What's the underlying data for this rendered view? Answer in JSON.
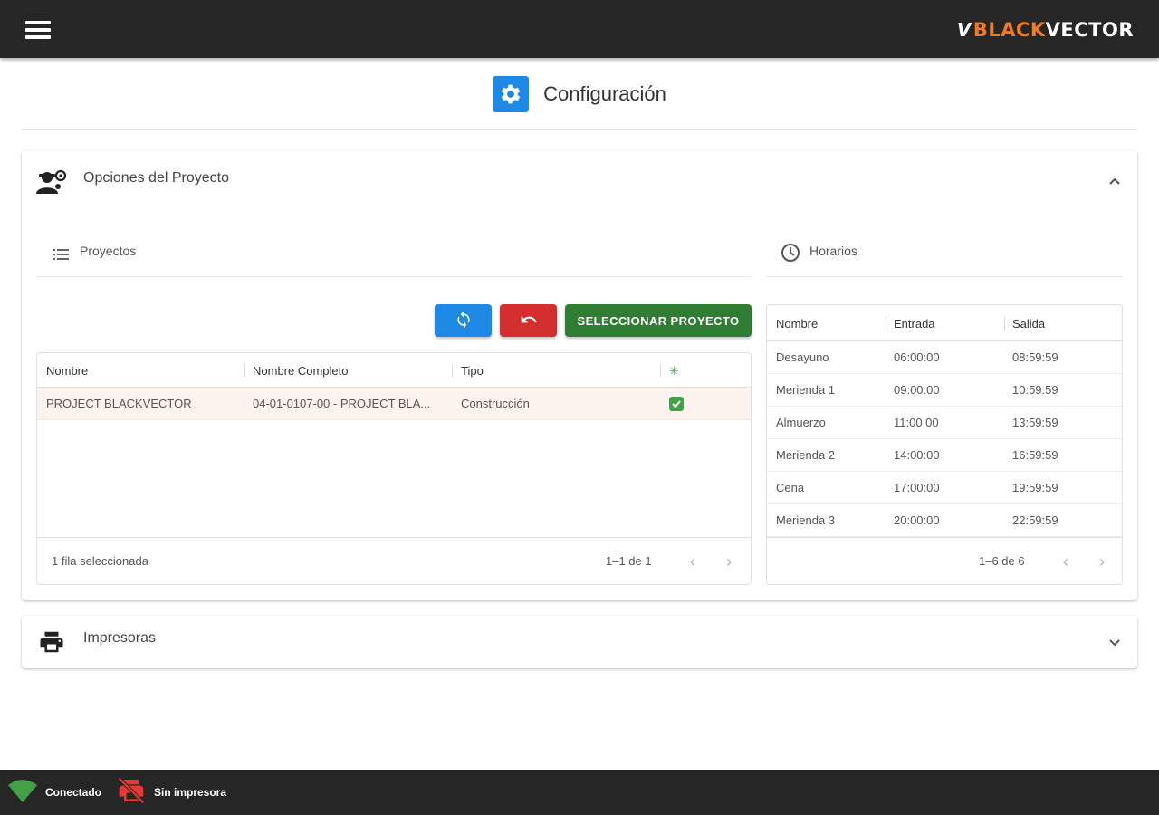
{
  "app": {
    "logo_mark": "V",
    "logo_black": "BLACK",
    "logo_vector": "VECTOR",
    "brand_color": "#f07c24"
  },
  "header": {
    "title": "Configuración",
    "icon": "gear-icon"
  },
  "project_panel": {
    "label": "Opciones del Proyecto",
    "icon": "user-settings-icon",
    "expanded": true,
    "projects": {
      "label": "Proyectos",
      "icon": "list-icon",
      "buttons": {
        "refresh_icon": "refresh-icon",
        "undo_icon": "undo-icon",
        "select_label": "SELECCIONAR PROYECTO"
      },
      "columns": [
        "Nombre",
        "Nombre Completo",
        "Tipo",
        "✳"
      ],
      "rows": [
        {
          "nombre": "PROJECT BLACKVECTOR",
          "nombre_completo": "04-01-0107-00 - PROJECT BLA...",
          "tipo": "Construcción",
          "active": "check-icon"
        }
      ],
      "footer": {
        "selected": "1 fila seleccionada",
        "range": "1–1 de 1"
      }
    },
    "horarios": {
      "label": "Horarios",
      "icon": "clock-icon",
      "columns": [
        "Nombre",
        "Entrada",
        "Salida"
      ],
      "rows": [
        {
          "nombre": "Desayuno",
          "entrada": "06:00:00",
          "salida": "08:59:59"
        },
        {
          "nombre": "Merienda 1",
          "entrada": "09:00:00",
          "salida": "10:59:59"
        },
        {
          "nombre": "Almuerzo",
          "entrada": "11:00:00",
          "salida": "13:59:59"
        },
        {
          "nombre": "Merienda 2",
          "entrada": "14:00:00",
          "salida": "16:59:59"
        },
        {
          "nombre": "Cena",
          "entrada": "17:00:00",
          "salida": "19:59:59"
        },
        {
          "nombre": "Merienda 3",
          "entrada": "20:00:00",
          "salida": "22:59:59"
        }
      ],
      "footer": {
        "range": "1–6 de 6"
      }
    }
  },
  "printers_panel": {
    "label": "Impresoras",
    "icon": "printer-icon",
    "expanded": false
  },
  "status": {
    "connection_label": "Conectado",
    "connection_color": "#43a047",
    "printer_label": "Sin impresora",
    "printer_color": "#e53935"
  }
}
